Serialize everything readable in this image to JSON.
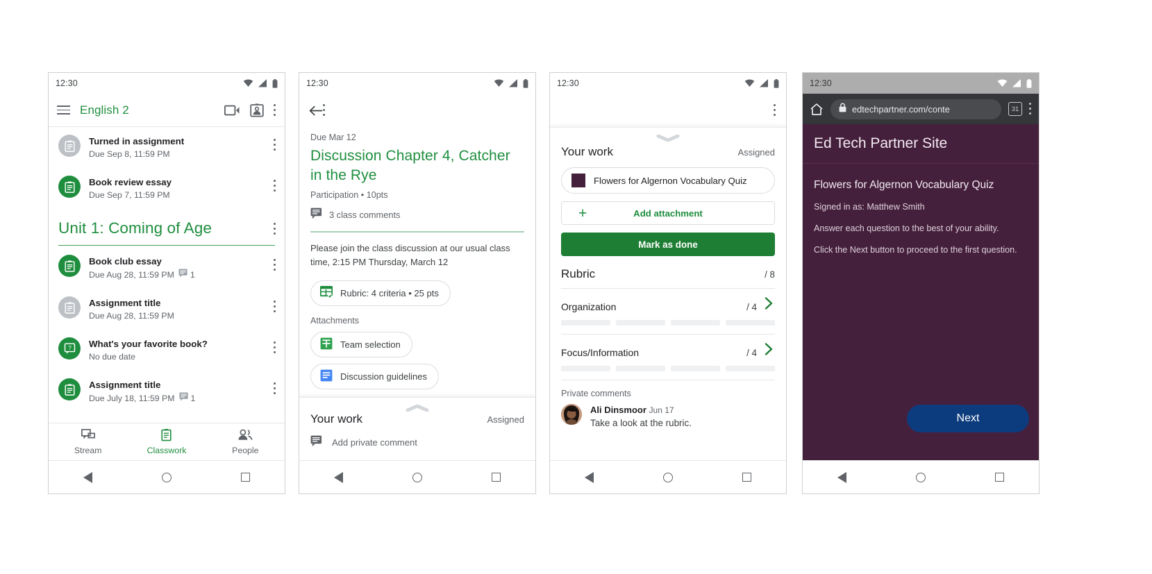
{
  "status_bar": {
    "time": "12:30"
  },
  "phone1": {
    "appbar": {
      "title": "English 2",
      "menu_icon": "hamburger-icon",
      "meet_icon": "video-camera-icon",
      "roster_icon": "id-badge-icon",
      "more_icon": "kebab-menu-icon"
    },
    "top_items": [
      {
        "title": "Turned in assignment",
        "subtitle": "Due Sep 8, 11:59 PM",
        "icon": "assignment-icon",
        "state": "gray",
        "comments": ""
      },
      {
        "title": "Book review essay",
        "subtitle": "Due Sep 7, 11:59 PM",
        "icon": "assignment-icon",
        "state": "green",
        "comments": ""
      }
    ],
    "unit": {
      "title": "Unit 1: Coming of Age"
    },
    "unit_items": [
      {
        "title": "Book club essay",
        "subtitle": "Due Aug 28, 11:59 PM",
        "icon": "assignment-icon",
        "state": "green",
        "comments": "1"
      },
      {
        "title": "Assignment title",
        "subtitle": "Due Aug 28, 11:59 PM",
        "icon": "assignment-icon",
        "state": "gray",
        "comments": ""
      },
      {
        "title": "What's your favorite book?",
        "subtitle": "No due date",
        "icon": "question-icon",
        "state": "green",
        "comments": ""
      },
      {
        "title": "Assignment title",
        "subtitle": "Due July 18, 11:59 PM",
        "icon": "assignment-icon",
        "state": "green",
        "comments": "1"
      }
    ],
    "tabs": [
      {
        "label": "Stream",
        "icon": "stream-icon",
        "active": false
      },
      {
        "label": "Classwork",
        "icon": "classwork-icon",
        "active": true
      },
      {
        "label": "People",
        "icon": "people-icon",
        "active": false
      }
    ]
  },
  "phone2": {
    "back_icon": "back-arrow-icon",
    "more_icon": "kebab-menu-icon",
    "due": "Due Mar 12",
    "title": "Discussion Chapter 4, Catcher in the Rye",
    "points": "Participation • 10pts",
    "class_comments": "3 class comments",
    "description": "Please join the class discussion at our usual class time, 2:15 PM Thursday, March 12",
    "rubric_chip": "Rubric: 4 criteria • 25 pts",
    "attachments_label": "Attachments",
    "attachments": [
      {
        "label": "Team selection",
        "icon": "google-sheets-icon"
      },
      {
        "label": "Discussion guidelines",
        "icon": "google-docs-icon"
      }
    ],
    "your_work": {
      "heading": "Your work",
      "status": "Assigned"
    },
    "private_comment_placeholder": "Add private comment"
  },
  "phone3": {
    "more_icon": "kebab-menu-icon",
    "your_work": {
      "heading": "Your work",
      "status": "Assigned"
    },
    "attachment_chip": "Flowers for Algernon Vocabulary Quiz",
    "add_attachment": "Add attachment",
    "mark_as_done": "Mark as done",
    "rubric": {
      "heading": "Rubric",
      "score": "/ 8"
    },
    "criteria": [
      {
        "name": "Organization",
        "score": "/ 4",
        "segments": 4
      },
      {
        "name": "Focus/Information",
        "score": "/ 4",
        "segments": 4
      }
    ],
    "private_comments_label": "Private comments",
    "comment": {
      "author": "Ali Dinsmoor",
      "date": "Jun 17",
      "text": "Take a look at the rubric."
    }
  },
  "phone4": {
    "browser": {
      "home_icon": "home-icon",
      "lock_icon": "lock-icon",
      "url": "edtechpartner.com/conte",
      "tab_count": "31",
      "more_icon": "kebab-menu-icon"
    },
    "site_title": "Ed Tech Partner Site",
    "quiz_title": "Flowers for Algernon Vocabulary Quiz",
    "lines": [
      "Signed in as: Matthew Smith",
      "Answer each question to the best of your ability.",
      "Click the Next button to proceed to the first question."
    ],
    "next_button": "Next"
  },
  "colors": {
    "green": "#1e8e3e",
    "dark_green": "#1e7e34",
    "purple": "#45203c",
    "blue": "#0d3c7e",
    "gray_text": "#5f6368"
  }
}
